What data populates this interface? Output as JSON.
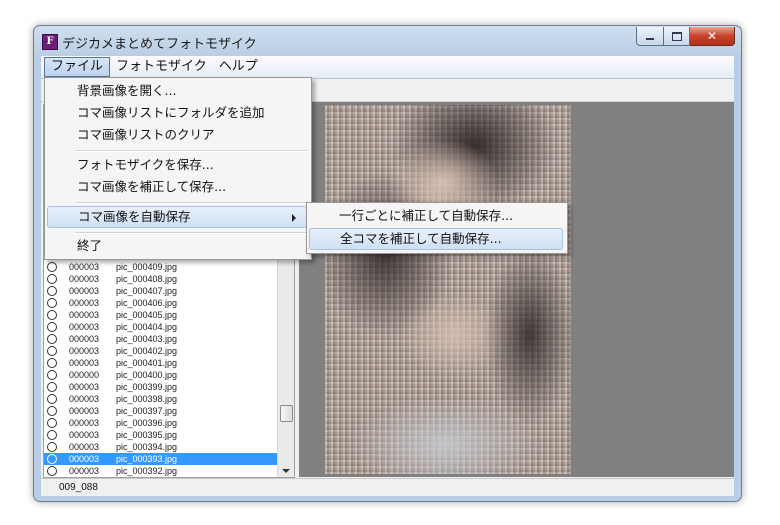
{
  "window": {
    "title": "デジカメまとめてフォトモザイク"
  },
  "menubar": {
    "items": [
      "ファイル",
      "フォトモザイク",
      "ヘルプ"
    ]
  },
  "file_menu": {
    "open_background": "背景画像を開く...",
    "add_folder": "コマ画像リストにフォルダを追加",
    "clear_list": "コマ画像リストのクリア",
    "save_mosaic": "フォトモザイクを保存...",
    "save_corrected": "コマ画像を補正して保存...",
    "auto_save": "コマ画像を自動保存",
    "exit": "終了"
  },
  "auto_save_submenu": {
    "per_row": "一行ごとに補正して自動保存...",
    "all_frames": "全コマを補正して自動保存..."
  },
  "list": {
    "rows": [
      {
        "count": "000003",
        "file": "pic_000409.jpg"
      },
      {
        "count": "000003",
        "file": "pic_000408.jpg"
      },
      {
        "count": "000003",
        "file": "pic_000407.jpg"
      },
      {
        "count": "000003",
        "file": "pic_000406.jpg"
      },
      {
        "count": "000003",
        "file": "pic_000405.jpg"
      },
      {
        "count": "000003",
        "file": "pic_000404.jpg"
      },
      {
        "count": "000003",
        "file": "pic_000403.jpg"
      },
      {
        "count": "000003",
        "file": "pic_000402.jpg"
      },
      {
        "count": "000003",
        "file": "pic_000401.jpg"
      },
      {
        "count": "000000",
        "file": "pic_000400.jpg"
      },
      {
        "count": "000003",
        "file": "pic_000399.jpg"
      },
      {
        "count": "000003",
        "file": "pic_000398.jpg"
      },
      {
        "count": "000003",
        "file": "pic_000397.jpg"
      },
      {
        "count": "000003",
        "file": "pic_000396.jpg"
      },
      {
        "count": "000003",
        "file": "pic_000395.jpg"
      },
      {
        "count": "000003",
        "file": "pic_000394.jpg"
      },
      {
        "count": "000003",
        "file": "pic_000393.jpg"
      },
      {
        "count": "000003",
        "file": "pic_000392.jpg"
      }
    ]
  },
  "status": {
    "position": "009_088"
  }
}
